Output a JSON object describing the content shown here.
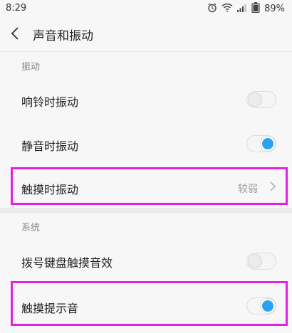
{
  "status_bar": {
    "time": "8:29",
    "battery": "89%",
    "icons": [
      "alarm-icon",
      "wifi-icon",
      "signal-icon",
      "battery-icon"
    ]
  },
  "header": {
    "title": "声音和振动"
  },
  "sections": {
    "vibration": {
      "label": "振动",
      "rows": {
        "ring_vibrate": {
          "label": "响铃时振动",
          "on": false
        },
        "silent_vibrate": {
          "label": "静音时振动",
          "on": true
        },
        "touch_vibrate": {
          "label": "触摸时振动",
          "value": "较弱"
        }
      }
    },
    "system": {
      "label": "系统",
      "rows": {
        "dialpad_sound": {
          "label": "拨号键盘触摸音效",
          "on": false
        },
        "touch_sound": {
          "label": "触摸提示音",
          "on": true
        }
      }
    }
  },
  "colors": {
    "accent": "#2aa2ef",
    "highlight": "#e61ee6"
  }
}
